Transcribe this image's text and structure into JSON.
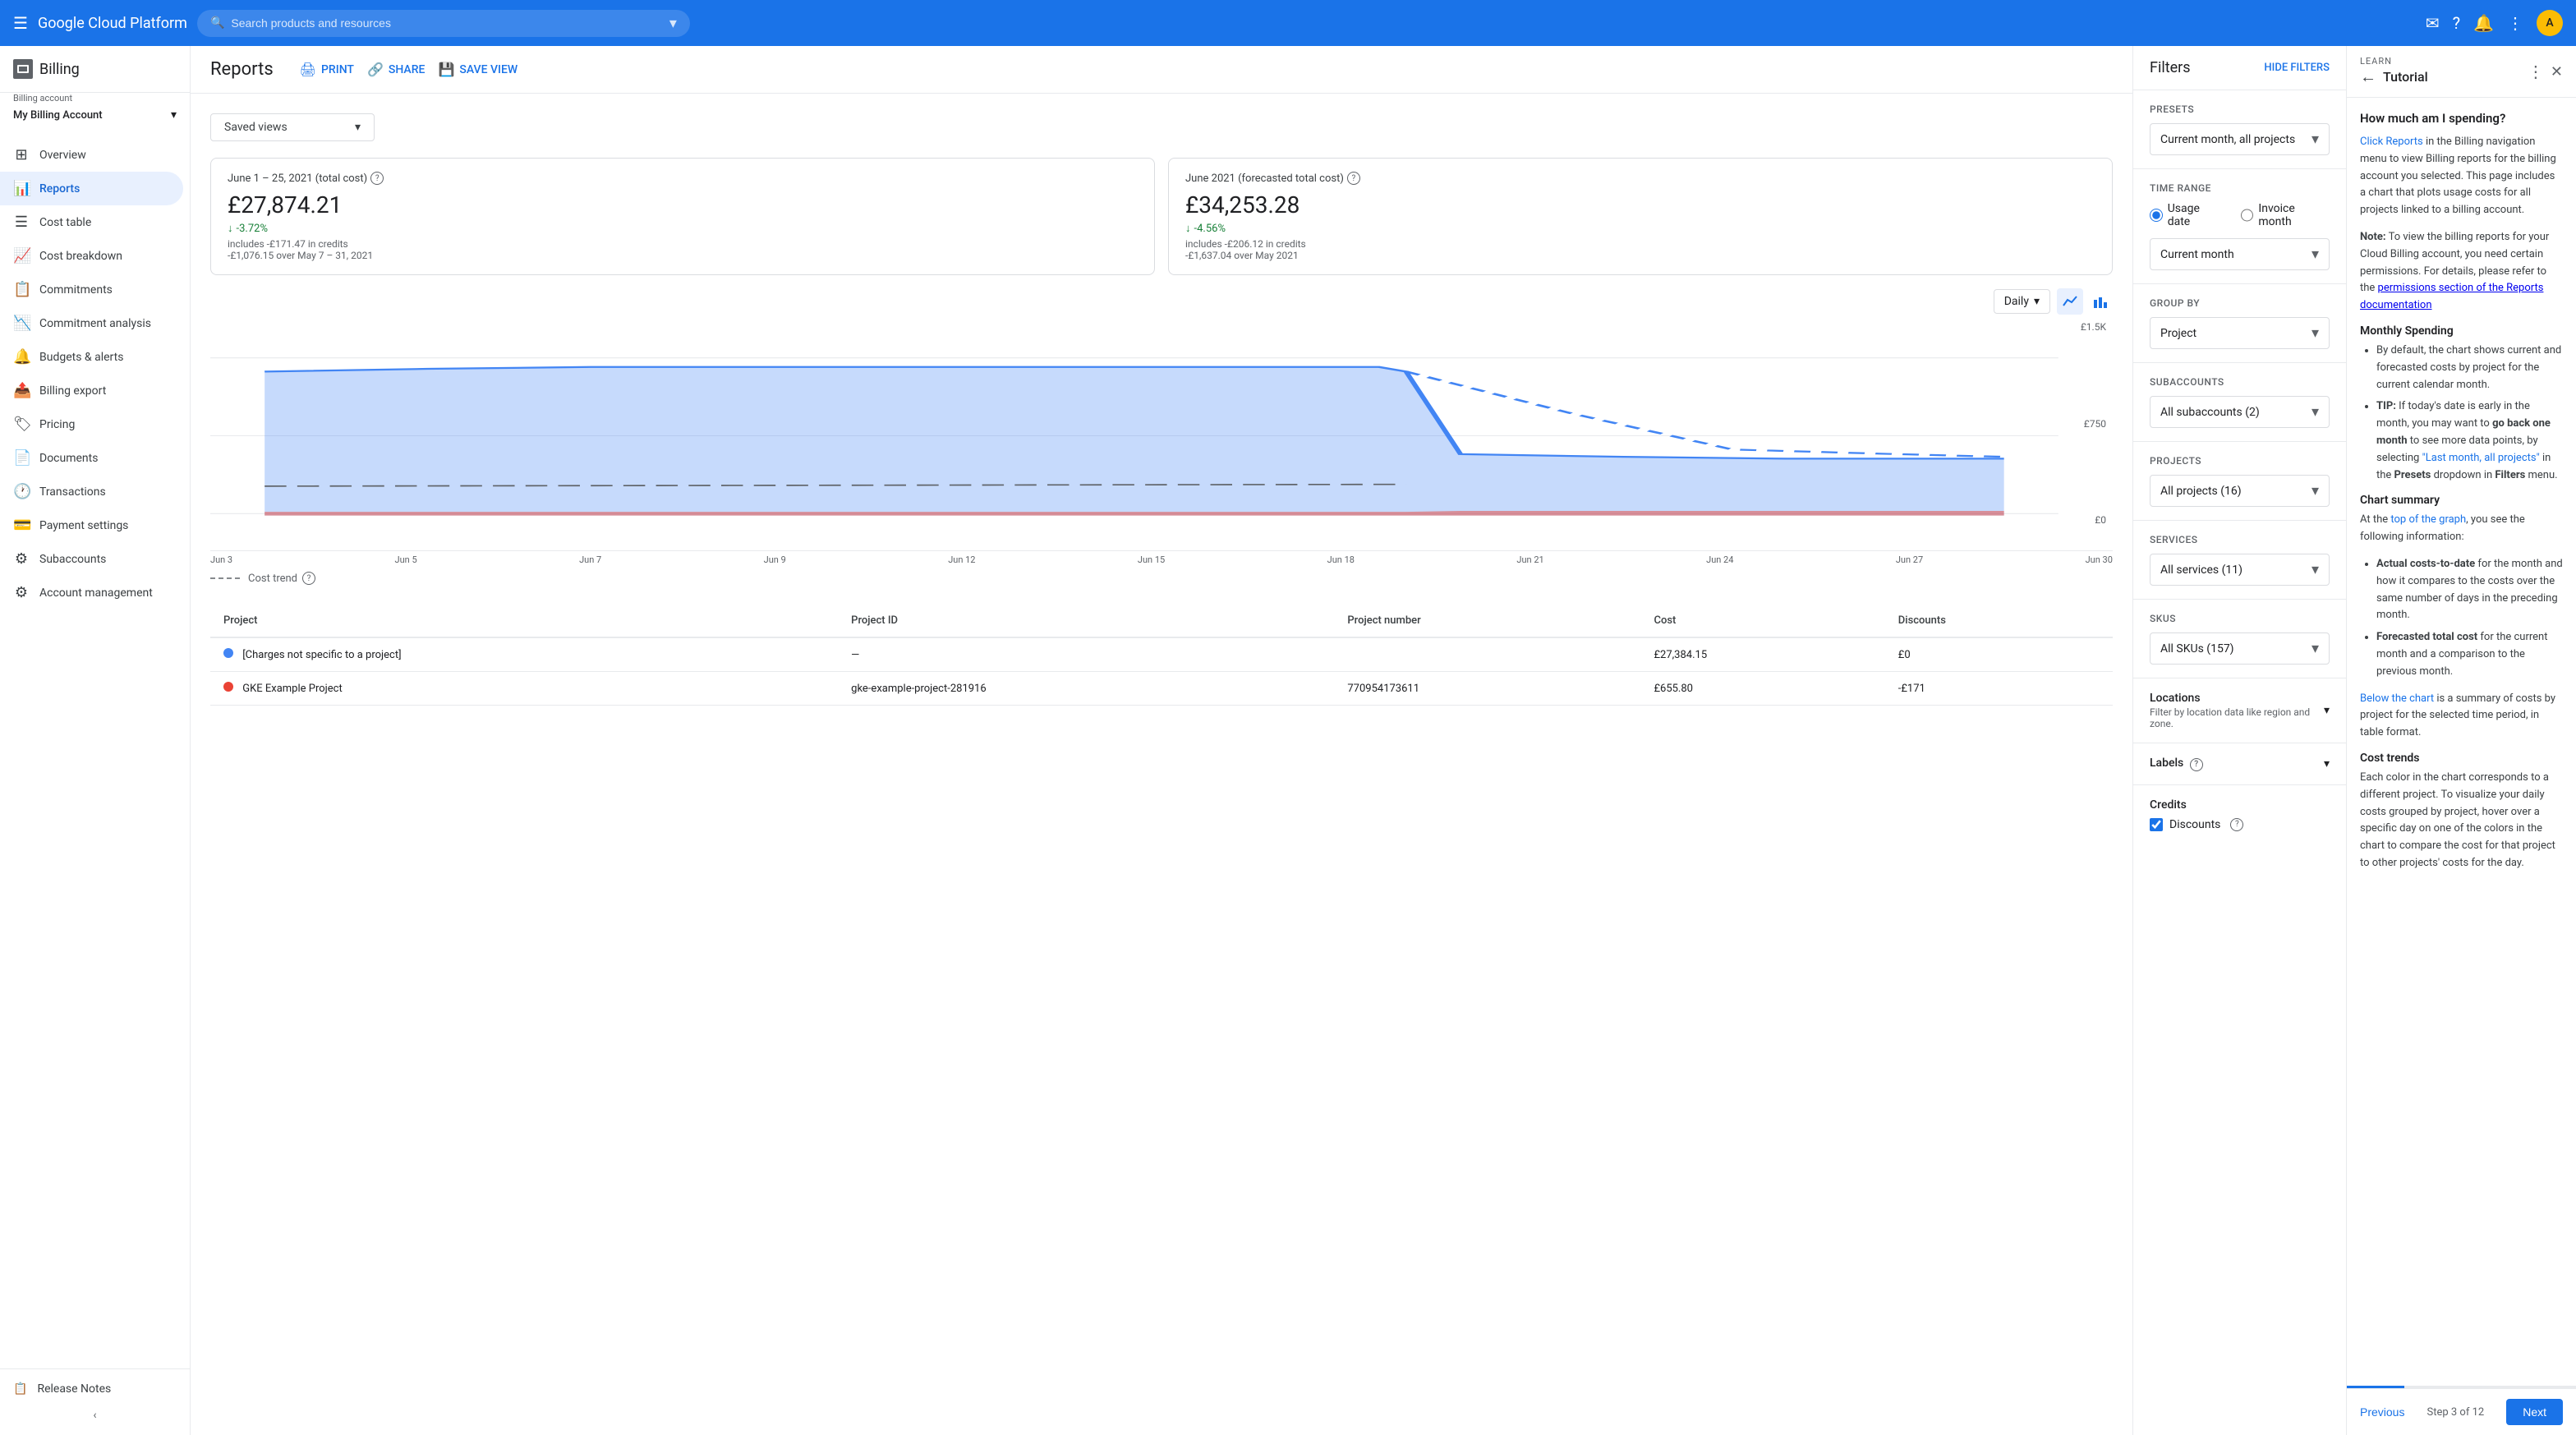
{
  "topnav": {
    "brand": "Google Cloud Platform",
    "search_placeholder": "Search products and resources",
    "avatar_letter": "A"
  },
  "sidebar": {
    "billing_label": "Billing",
    "billing_account_label": "Billing account",
    "billing_account_name": "My Billing Account",
    "nav_items": [
      {
        "id": "overview",
        "label": "Overview",
        "icon": "⊞"
      },
      {
        "id": "reports",
        "label": "Reports",
        "icon": "📊",
        "active": true
      },
      {
        "id": "cost-table",
        "label": "Cost table",
        "icon": "☰"
      },
      {
        "id": "cost-breakdown",
        "label": "Cost breakdown",
        "icon": "📈"
      },
      {
        "id": "commitments",
        "label": "Commitments",
        "icon": "📋"
      },
      {
        "id": "commitment-analysis",
        "label": "Commitment analysis",
        "icon": "📉"
      },
      {
        "id": "budgets-alerts",
        "label": "Budgets & alerts",
        "icon": "🔔"
      },
      {
        "id": "billing-export",
        "label": "Billing export",
        "icon": "📤"
      },
      {
        "id": "pricing",
        "label": "Pricing",
        "icon": "🏷"
      },
      {
        "id": "documents",
        "label": "Documents",
        "icon": "📄"
      },
      {
        "id": "transactions",
        "label": "Transactions",
        "icon": "🕐"
      },
      {
        "id": "payment-settings",
        "label": "Payment settings",
        "icon": "💳"
      },
      {
        "id": "subaccounts",
        "label": "Subaccounts",
        "icon": "⚙"
      },
      {
        "id": "account-management",
        "label": "Account management",
        "icon": "⚙"
      }
    ],
    "release_notes": "Release Notes"
  },
  "reports": {
    "title": "Reports",
    "actions": {
      "print": "PRINT",
      "share": "SHARE",
      "save_view": "SAVE VIEW"
    },
    "saved_views_label": "Saved views",
    "summary_cards": [
      {
        "title": "June 1 – 25, 2021 (total cost)",
        "amount": "£27,874.21",
        "change": "-3.72%",
        "note1": "includes -£171.47 in credits",
        "note2": "-£1,076.15 over May 7 – 31, 2021"
      },
      {
        "title": "June 2021 (forecasted total cost)",
        "amount": "£34,253.28",
        "change": "-4.56%",
        "note1": "includes -£206.12 in credits",
        "note2": "-£1,637.04 over May 2021"
      }
    ],
    "chart": {
      "time_filter": "Daily",
      "y_labels": [
        "£1.5K",
        "£750",
        "£0"
      ],
      "x_labels": [
        "Jun 3",
        "Jun 5",
        "Jun 7",
        "Jun 9",
        "Jun 12",
        "Jun 15",
        "Jun 18",
        "Jun 21",
        "Jun 24",
        "Jun 27",
        "Jun 30"
      ],
      "cost_trend_label": "Cost trend"
    },
    "table": {
      "headers": [
        "Project",
        "Project ID",
        "Project number",
        "Cost",
        "Discounts"
      ],
      "rows": [
        {
          "color": "#4285f4",
          "project": "[Charges not specific to a project]",
          "project_id": "—",
          "project_number": "",
          "cost": "£27,384.15",
          "discount": "£0"
        },
        {
          "color": "#ea4335",
          "project": "GKE Example Project",
          "project_id": "gke-example-project-281916",
          "project_number": "770954173611",
          "cost": "£655.80",
          "discount": "-£171"
        }
      ]
    }
  },
  "filters": {
    "title": "Filters",
    "hide_label": "HIDE FILTERS",
    "presets_label": "Presets",
    "presets_value": "Current month, all projects",
    "time_range_label": "Time range",
    "time_range_options": [
      {
        "id": "usage-date",
        "label": "Usage date",
        "selected": true
      },
      {
        "id": "invoice-month",
        "label": "Invoice month",
        "selected": false
      }
    ],
    "current_month_label": "Current month",
    "group_by_label": "Group by",
    "group_by_value": "Project",
    "subaccounts_label": "Subaccounts",
    "subaccounts_value": "All subaccounts (2)",
    "projects_label": "Projects",
    "projects_value": "All projects (16)",
    "services_label": "Services",
    "services_value": "All services (11)",
    "skus_label": "SKUs",
    "skus_value": "All SKUs (157)",
    "locations_label": "Locations",
    "locations_sub": "Filter by location data like region and zone.",
    "labels_label": "Labels",
    "credits_label": "Credits",
    "discounts_label": "Discounts",
    "discounts_checked": true
  },
  "tutorial": {
    "learn_label": "LEARN",
    "title": "Tutorial",
    "heading": "How much am I spending?",
    "text1": " in the Billing navigation menu to view Billing reports for the billing account you selected. This page includes a chart that plots usage costs for all projects linked to a billing account.",
    "text1_link": "Click Reports",
    "note_title": "Note:",
    "note_text": " To view the billing reports for your Cloud Billing account, you need certain permissions. For details, please refer to the ",
    "note_link": "permissions section of the Reports documentation",
    "monthly_spending_title": "Monthly Spending",
    "monthly_items": [
      "By default, the chart shows current and forecasted costs by project for the current calendar month.",
      "TIP: If today's date is early in the month, you may want to go back one month to see more data points, by selecting \"Last month, all projects\" in the Presets dropdown in Filters menu."
    ],
    "chart_summary_title": "Chart summary",
    "chart_summary_intro": "At the top of the graph, you see the following information:",
    "chart_summary_items": [
      "Actual costs-to-date for the month and how it compares to the costs over the same number of days in the preceding month.",
      "Forecasted total cost for the current month and a comparison to the previous month."
    ],
    "below_chart_text": "Below the chart is a summary of costs by project for the selected time period, in table format.",
    "cost_trends_title": "Cost trends",
    "cost_trends_text": "Each color in the chart corresponds to a different project. To visualize your daily costs grouped by project, hover over a specific day on one of the colors in the chart to compare the cost for that project to other projects' costs for the day.",
    "footer": {
      "prev_label": "Previous",
      "step_label": "Step 3 of 12",
      "next_label": "Next"
    }
  }
}
